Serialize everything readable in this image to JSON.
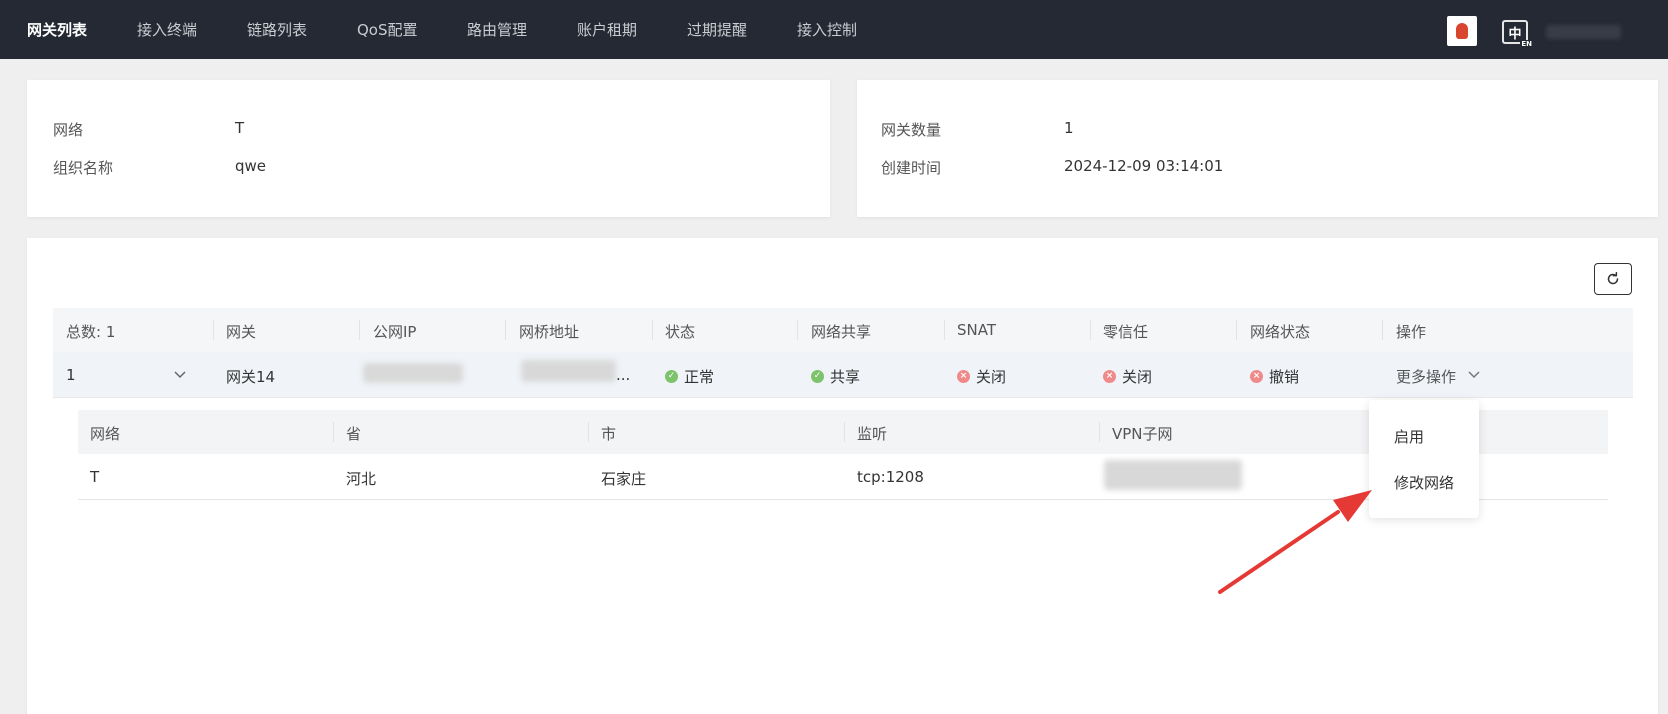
{
  "nav": {
    "items": [
      "网关列表",
      "接入终端",
      "链路列表",
      "QoS配置",
      "路由管理",
      "账户租期",
      "过期提醒",
      "接入控制"
    ],
    "lang_main": "中",
    "lang_sub": "EN"
  },
  "info_left": {
    "network_label": "网络",
    "network_value": "T",
    "org_label": "组织名称",
    "org_value": "qwe"
  },
  "info_right": {
    "count_label": "网关数量",
    "count_value": "1",
    "created_label": "创建时间",
    "created_value": "2024-12-09 03:14:01"
  },
  "table": {
    "headers": [
      "总数: 1",
      "网关",
      "公网IP",
      "网桥地址",
      "状态",
      "网络共享",
      "SNAT",
      "零信任",
      "网络状态",
      "操作"
    ],
    "row": {
      "index": "1",
      "gateway": "网关14",
      "bridge_suffix": "...",
      "status": "正常",
      "share": "共享",
      "snat": "关闭",
      "zero_trust": "关闭",
      "net_status": "撤销",
      "action": "更多操作"
    }
  },
  "sub_table": {
    "headers": [
      "网络",
      "省",
      "市",
      "监听",
      "VPN子网"
    ],
    "row": [
      "T",
      "河北",
      "石家庄",
      "tcp:1208"
    ]
  },
  "dropdown": {
    "items": [
      "启用",
      "修改网络"
    ]
  },
  "colors": {
    "nav_bg": "#242933",
    "ok": "#7cc36b",
    "error": "#f08a8a",
    "arrow": "#e53935"
  }
}
